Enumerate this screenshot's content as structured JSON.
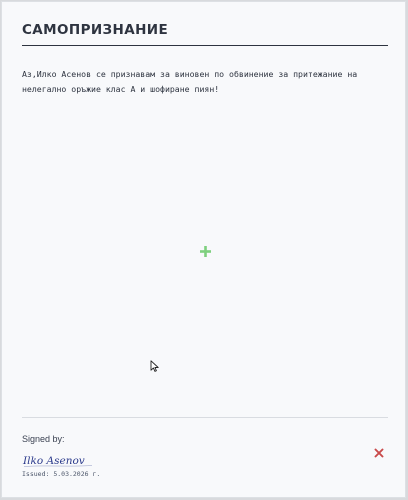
{
  "document": {
    "title": "САМОПРИЗНАНИЕ",
    "body": "Аз,Илко Асенов се признавам за виновен по обвинение за притежание на нелегално оръжие клас А и шофиране пиян!"
  },
  "footer": {
    "signed_label": "Signed by:",
    "signature_name": "Ilko Asenov",
    "issued_label": "Issued:",
    "issued_date": "5.03.2026 г."
  },
  "icons": {
    "crosshair": "plus-icon",
    "pointer": "cursor-icon",
    "close": "close-icon"
  },
  "colors": {
    "crosshair": "#7ed07e",
    "close": "#c94a4a",
    "signature": "#2b3a8c"
  }
}
